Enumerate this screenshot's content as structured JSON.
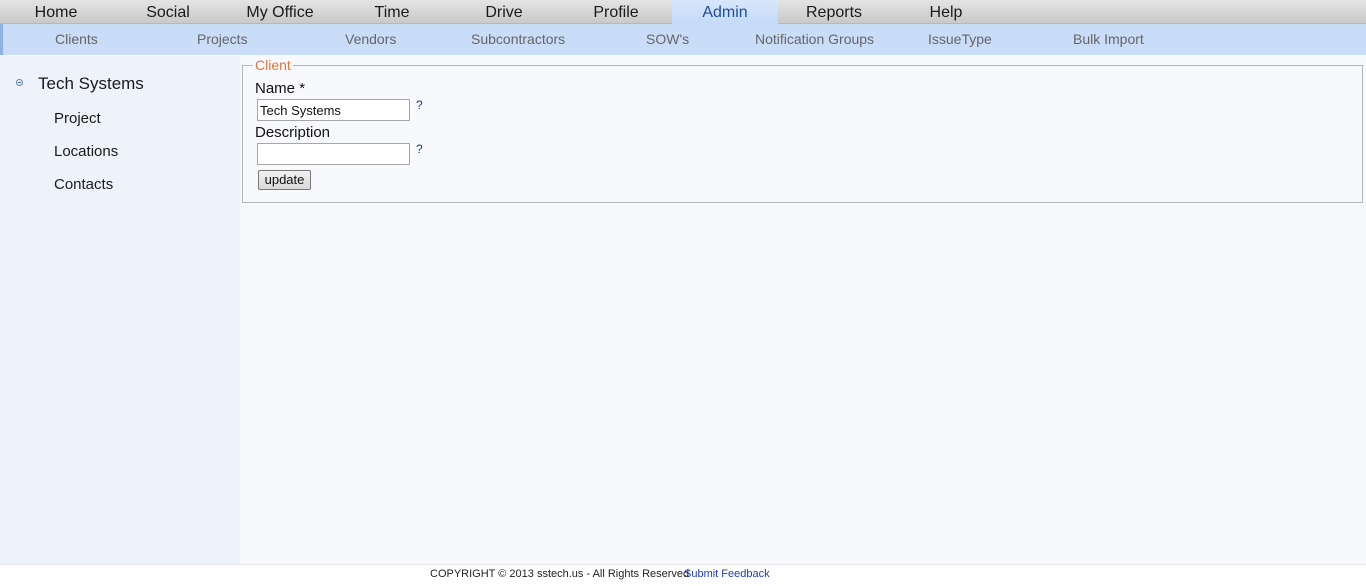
{
  "top_nav": [
    {
      "label": "Home"
    },
    {
      "label": "Social"
    },
    {
      "label": "My Office"
    },
    {
      "label": "Time"
    },
    {
      "label": "Drive"
    },
    {
      "label": "Profile"
    },
    {
      "label": "Admin",
      "active": true
    },
    {
      "label": "Reports"
    },
    {
      "label": "Help"
    }
  ],
  "sub_nav": [
    {
      "label": "Clients"
    },
    {
      "label": "Projects"
    },
    {
      "label": "Vendors"
    },
    {
      "label": "Subcontractors"
    },
    {
      "label": "SOW's"
    },
    {
      "label": "Notification Groups"
    },
    {
      "label": "IssueType"
    },
    {
      "label": "Bulk Import"
    }
  ],
  "sidebar": {
    "root": "Tech Systems",
    "toggle_icon": "collapse-icon",
    "children": [
      "Project",
      "Locations",
      "Contacts"
    ]
  },
  "form": {
    "legend": "Client",
    "name_label": "Name",
    "required_mark": "*",
    "name_value": "Tech Systems",
    "description_label": "Description",
    "description_value": "",
    "help_mark": "?",
    "update_label": "update"
  },
  "footer": {
    "copyright": "COPYRIGHT © 2013 sstech.us - All Rights Reserved",
    "feedback_link": "Submit Feedback"
  },
  "colors": {
    "active_tab_text": "#1f4e9a",
    "subnav_bg": "#c9dcf8",
    "legend": "#e0773a",
    "link": "#1f3fb0"
  }
}
